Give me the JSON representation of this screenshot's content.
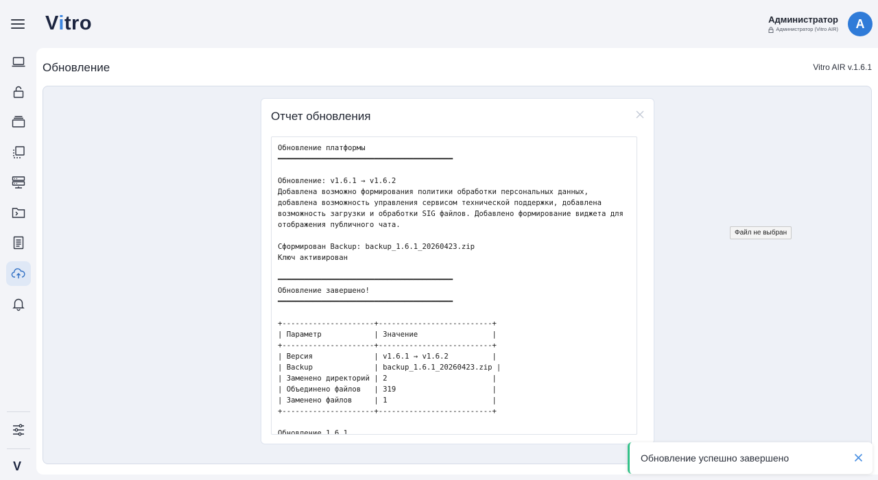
{
  "header": {
    "logo": {
      "prefix": "V",
      "accent": "i",
      "suffix": "tro"
    },
    "user_name": "Администратор",
    "user_role": "Администратор (Vitro AIR)",
    "avatar_letter": "A"
  },
  "sidebar": {
    "items": [
      {
        "icon": "laptop-icon"
      },
      {
        "icon": "unlock-icon"
      },
      {
        "icon": "layers-icon"
      },
      {
        "icon": "crop-icon"
      },
      {
        "icon": "server-icon"
      },
      {
        "icon": "terminal-folder-icon"
      },
      {
        "icon": "document-icon"
      },
      {
        "icon": "cloud-upload-icon",
        "active": true
      },
      {
        "icon": "bell-icon"
      }
    ],
    "bottom": [
      {
        "icon": "settings-sliders-icon"
      },
      {
        "icon": "vitro-logo-icon"
      }
    ],
    "bottom_logo": "V"
  },
  "page": {
    "title": "Обновление",
    "version": "Vitro AIR v.1.6.1"
  },
  "tooltip": "Файл не выбран",
  "modal": {
    "title": "Отчет обновления",
    "report_lines": [
      "Обновление платформы",
      "━━━━━━━━━━━━━━━━━━━━━━━━━━━━━━━━━━━━━━━━",
      "",
      "Обновление: v1.6.1 → v1.6.2",
      "Добавлена возможно формирования политики обработки персональных данных,",
      "добавлена возможность управления сервисом технической поддержки, добавлена",
      "возможность загрузки и обработки SIG файлов. Добавлено формирование виджета для",
      "отображения публичного чата.",
      "",
      "Сформирован Backup: backup_1.6.1_20260423.zip",
      "Ключ активирован",
      "",
      "━━━━━━━━━━━━━━━━━━━━━━━━━━━━━━━━━━━━━━━━",
      "Обновление завершено!",
      "━━━━━━━━━━━━━━━━━━━━━━━━━━━━━━━━━━━━━━━━",
      "",
      "+---------------------+--------------------------+",
      "| Параметр            | Значение                 |",
      "+---------------------+--------------------------+",
      "| Версия              | v1.6.1 → v1.6.2          |",
      "| Backup              | backup_1.6.1_20260423.zip |",
      "| Заменено директорий | 2                        |",
      "| Объединено файлов   | 319                      |",
      "| Заменено файлов     | 1                        |",
      "+---------------------+--------------------------+",
      "",
      "Обновление 1.6.1"
    ]
  },
  "toast": {
    "message": "Обновление успешно завершено",
    "accent_color": "#35c28a"
  },
  "colors": {
    "primary": "#2f7bd8",
    "background": "#f3f4f8"
  }
}
